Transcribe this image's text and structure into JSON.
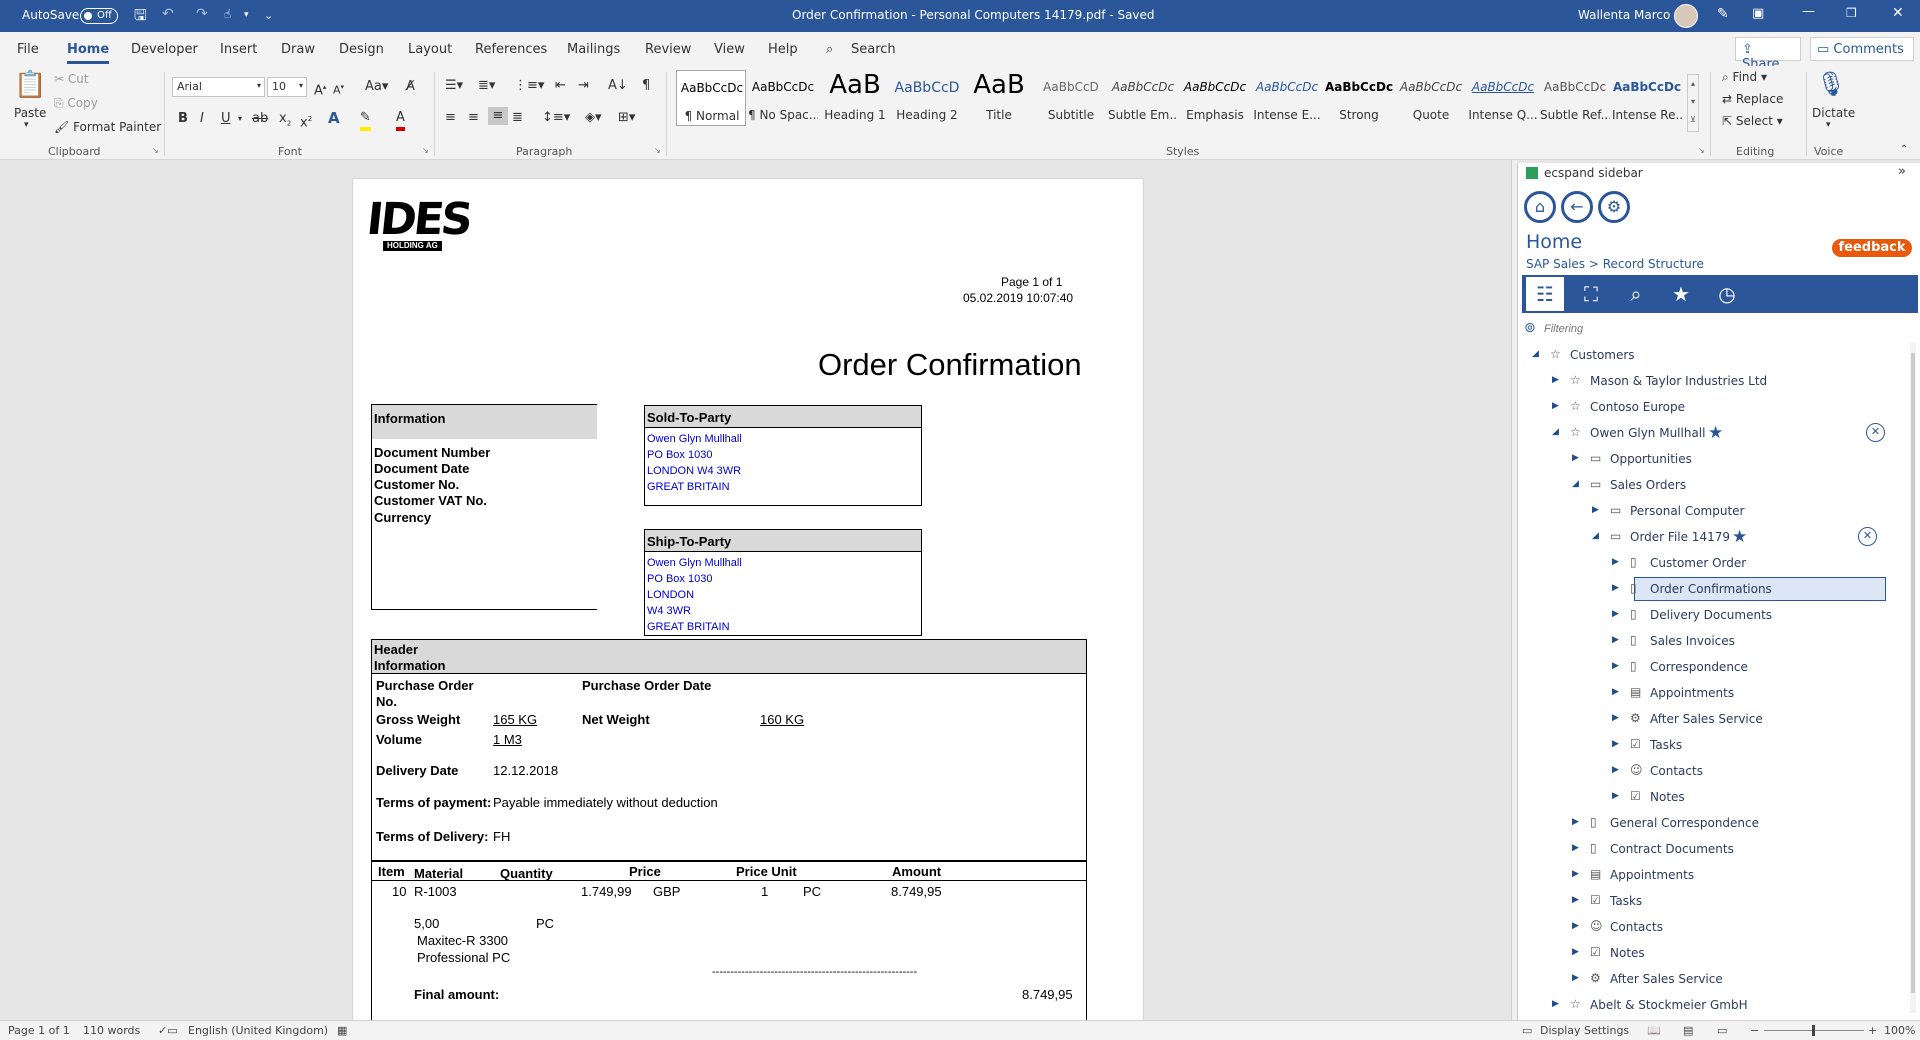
{
  "titlebar": {
    "autosave_label": "AutoSave",
    "autosave_state": "Off",
    "doc_title": "Order Confirmation - Personal Computers 14179.pdf  -  Saved",
    "user_name": "Wallenta Marco"
  },
  "tabs": [
    "File",
    "Home",
    "Developer",
    "Insert",
    "Draw",
    "Design",
    "Layout",
    "References",
    "Mailings",
    "Review",
    "View",
    "Help"
  ],
  "search_label": "Search",
  "share_label": "Share",
  "comments_label": "Comments",
  "clipboard": {
    "paste": "Paste",
    "cut": "Cut",
    "copy": "Copy",
    "format_painter": "Format Painter",
    "label": "Clipboard"
  },
  "font": {
    "name": "Arial",
    "size": "10",
    "label": "Font"
  },
  "paragraph_label": "Paragraph",
  "styles": {
    "label": "Styles",
    "items": [
      {
        "preview": "AaBbCcDc",
        "name": "¶ Normal"
      },
      {
        "preview": "AaBbCcDc",
        "name": "¶ No Spac..."
      },
      {
        "preview": "AaB",
        "name": "Heading 1"
      },
      {
        "preview": "AaBbCcD",
        "name": "Heading 2"
      },
      {
        "preview": "AaB",
        "name": "Title"
      },
      {
        "preview": "AaBbCcD",
        "name": "Subtitle"
      },
      {
        "preview": "AaBbCcDc",
        "name": "Subtle Em..."
      },
      {
        "preview": "AaBbCcDc",
        "name": "Emphasis"
      },
      {
        "preview": "AaBbCcDc",
        "name": "Intense E..."
      },
      {
        "preview": "AaBbCcDc",
        "name": "Strong"
      },
      {
        "preview": "AaBbCcDc",
        "name": "Quote"
      },
      {
        "preview": "AaBbCcDc",
        "name": "Intense Q..."
      },
      {
        "preview": "AaBbCcDc",
        "name": "Subtle Ref..."
      },
      {
        "preview": "AaBbCcDc",
        "name": "Intense Re..."
      }
    ]
  },
  "editing": {
    "find": "Find",
    "replace": "Replace",
    "select": "Select",
    "label": "Editing"
  },
  "voice": {
    "dictate": "Dictate",
    "label": "Voice"
  },
  "document": {
    "logo_text": "IDES",
    "logo_sub": "HOLDING AG",
    "page_of": "Page 1 of 1",
    "datetime": "05.02.2019 10:07:40",
    "title": "Order Confirmation",
    "info_header": "Information",
    "info_labels": [
      "Document Number",
      "Document Date",
      "Customer No.",
      "Customer VAT No.",
      "Currency"
    ],
    "sold_to": {
      "header": "Sold-To-Party",
      "lines": [
        "Owen Glyn Mullhall",
        "PO Box 1030",
        "LONDON W4 3WR",
        "GREAT BRITAIN"
      ]
    },
    "ship_to": {
      "header": "Ship-To-Party",
      "lines": [
        "Owen Glyn Mullhall",
        "PO Box 1030",
        "LONDON",
        "W4 3WR",
        "GREAT BRITAIN"
      ]
    },
    "header_info": "Header Information",
    "po_no": "Purchase Order No.",
    "po_date": "Purchase Order Date",
    "gross_weight_label": "Gross Weight",
    "gross_weight": "165  KG",
    "net_weight_label": "Net Weight",
    "net_weight": "160  KG",
    "volume_label": "Volume",
    "volume": "1  M3",
    "delivery_date_label": "Delivery Date",
    "delivery_date": "12.12.2018",
    "terms_payment_label": "Terms of payment:",
    "terms_payment": "Payable immediately without deduction",
    "terms_delivery_label": "Terms of Delivery:",
    "terms_delivery": "FH",
    "columns": [
      "Item",
      "Material",
      "Quantity",
      "Price",
      "Price Unit",
      "Amount"
    ],
    "item": {
      "no": "10",
      "material": "R-1003",
      "price": "1.749,99",
      "currency": "GBP",
      "unit_qty": "1",
      "unit": "PC",
      "amount": "8.749,95",
      "quantity": "5,00",
      "qty_unit": "PC",
      "desc1": "Maxitec-R 3300",
      "desc2": "Professional PC"
    },
    "dashes": "--------------------------------------------------------",
    "final_amount_label": "Final amount:",
    "final_amount": "8.749,95"
  },
  "sidebar": {
    "title": "ecspand sidebar",
    "home": "Home",
    "breadcrumb": "SAP Sales > Record Structure",
    "feedback": "feedback",
    "filter_placeholder": "Filtering",
    "tree": [
      {
        "label": "Customers"
      },
      {
        "label": "Mason & Taylor Industries Ltd"
      },
      {
        "label": "Contoso Europe"
      },
      {
        "label": "Owen Glyn Mullhall"
      },
      {
        "label": "Opportunities"
      },
      {
        "label": "Sales Orders"
      },
      {
        "label": "Personal Computer"
      },
      {
        "label": "Order File 14179"
      },
      {
        "label": "Customer Order"
      },
      {
        "label": "Order Confirmations"
      },
      {
        "label": "Delivery Documents"
      },
      {
        "label": "Sales Invoices"
      },
      {
        "label": "Correspondence"
      },
      {
        "label": "Appointments"
      },
      {
        "label": "After Sales Service"
      },
      {
        "label": "Tasks"
      },
      {
        "label": "Contacts"
      },
      {
        "label": "Notes"
      },
      {
        "label": "General Correspondence"
      },
      {
        "label": "Contract Documents"
      },
      {
        "label": "Appointments"
      },
      {
        "label": "Tasks"
      },
      {
        "label": "Contacts"
      },
      {
        "label": "Notes"
      },
      {
        "label": "After Sales Service"
      },
      {
        "label": "Abelt & Stockmeier GmbH"
      }
    ]
  },
  "status": {
    "page": "Page 1 of 1",
    "words": "110 words",
    "language": "English (United Kingdom)",
    "display_settings": "Display Settings",
    "zoom": "100%"
  }
}
